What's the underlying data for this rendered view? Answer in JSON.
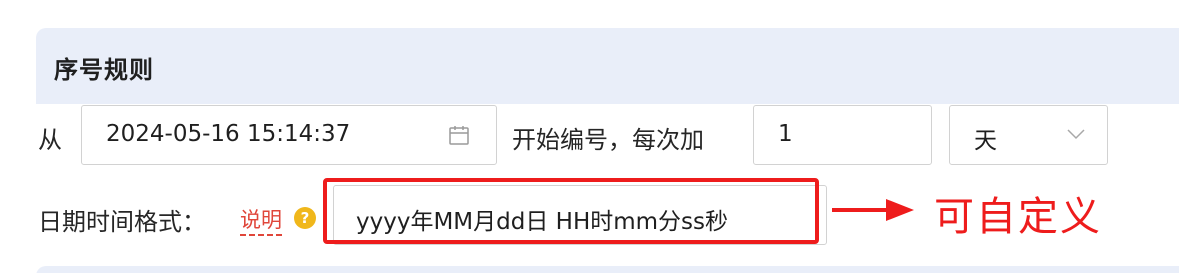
{
  "section": {
    "title": "序号规则"
  },
  "row1": {
    "from_label": "从",
    "date_value": "2024-05-16 15:14:37",
    "start_label": "开始编号，每次加",
    "step_value": "1",
    "unit_value": "天"
  },
  "row2": {
    "format_label": "日期时间格式：",
    "help_link": "说明",
    "help_icon": "?",
    "format_value": "yyyy年MM月dd日 HH时mm分ss秒"
  },
  "annotation": {
    "text": "可自定义",
    "color": "#ee1c1c"
  },
  "icons": {
    "calendar": "calendar-icon",
    "dropdown": "chevron-down-icon",
    "help": "question-circle-icon",
    "arrow": "arrow-right-icon"
  },
  "colors": {
    "section_bg": "#e9eef9",
    "help_link": "#e0463a",
    "help_icon": "#f0b71b"
  }
}
